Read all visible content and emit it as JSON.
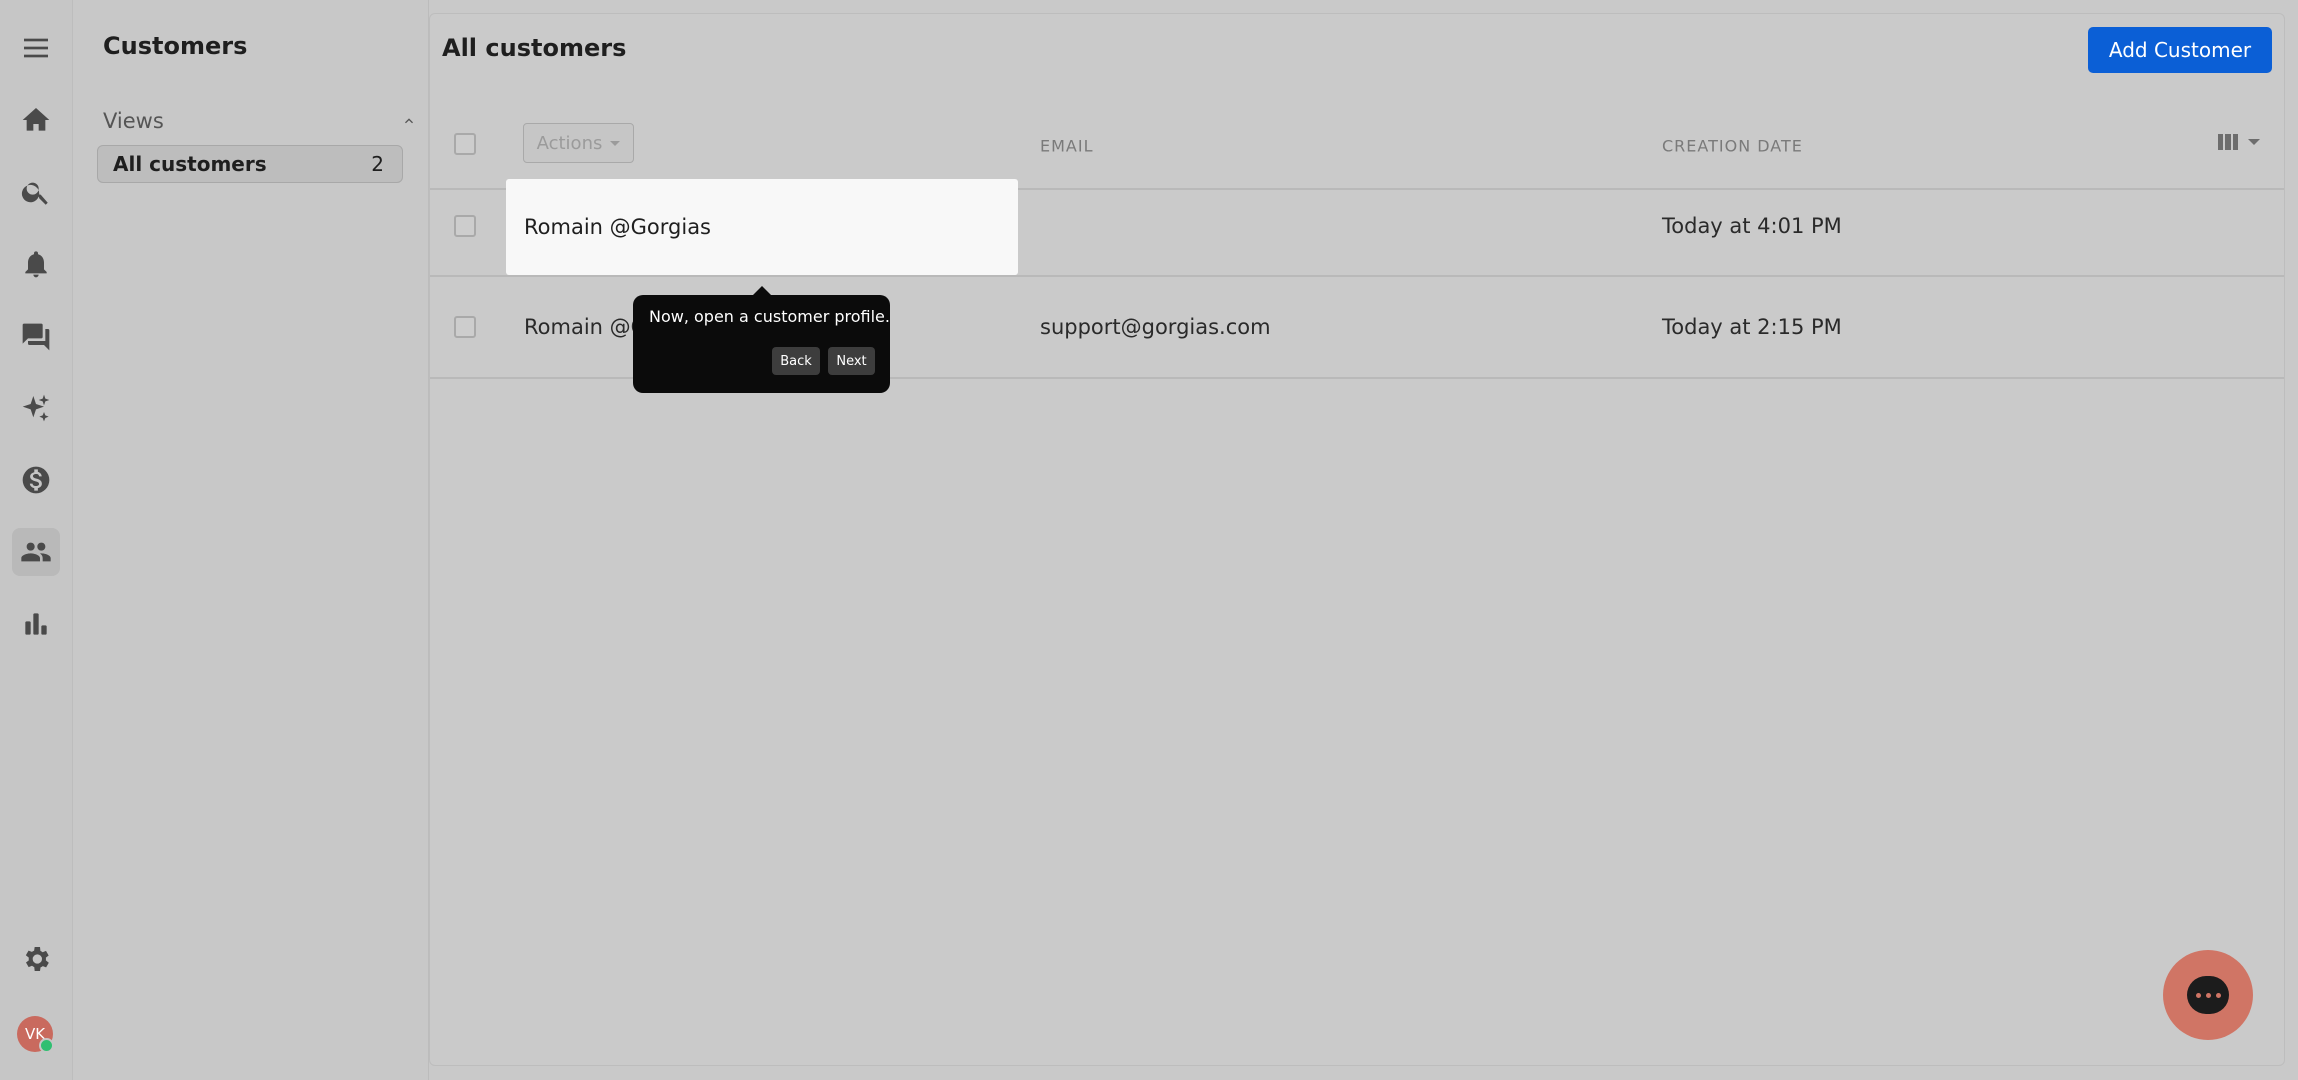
{
  "rail": {
    "items": [
      {
        "icon": "menu-icon"
      },
      {
        "icon": "home-icon"
      },
      {
        "icon": "search-icon"
      },
      {
        "icon": "bell-icon"
      },
      {
        "icon": "chat-icon"
      },
      {
        "icon": "sparkle-icon"
      },
      {
        "icon": "dollar-icon"
      },
      {
        "icon": "customers-icon",
        "active": true
      },
      {
        "icon": "statistics-icon"
      },
      {
        "icon": "gear-icon"
      }
    ],
    "avatar_initials": "VK"
  },
  "sidebar": {
    "title": "Customers",
    "section_label": "Views",
    "views": [
      {
        "label": "All customers",
        "count": "2"
      }
    ]
  },
  "main": {
    "title": "All customers",
    "add_button": "Add Customer",
    "actions_label": "Actions",
    "columns": {
      "email": "EMAIL",
      "creation_date": "CREATION DATE"
    },
    "rows": [
      {
        "name": "Romain @Gorgias",
        "email": "",
        "date": "Today at 4:01 PM"
      },
      {
        "name": "Romain @Gorgias",
        "email": "support@gorgias.com",
        "date": "Today at 2:15 PM"
      }
    ]
  },
  "tour": {
    "message": "Now, open a customer profile.",
    "back_label": "Back",
    "next_label": "Next"
  },
  "colors": {
    "accent": "#0b5fd6",
    "chat_launcher": "#d07565",
    "tooltip": "#0b0b0b"
  }
}
